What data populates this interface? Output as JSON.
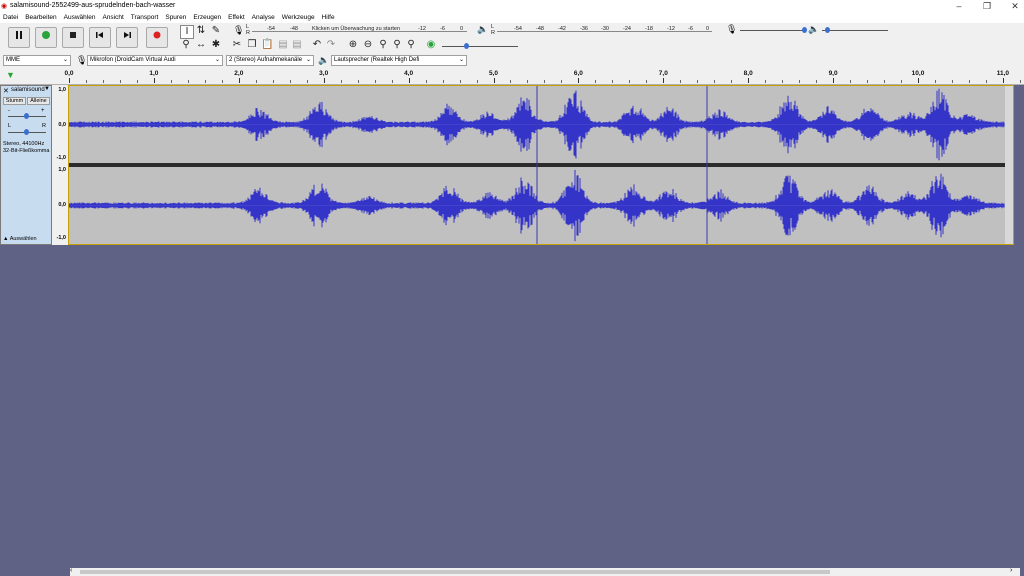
{
  "window": {
    "title": "salamisound-2552499-aus-sprudelnden-bach-wasser"
  },
  "menu": [
    "Datei",
    "Bearbeiten",
    "Auswählen",
    "Ansicht",
    "Transport",
    "Spuren",
    "Erzeugen",
    "Effekt",
    "Analyse",
    "Werkzeuge",
    "Hilfe"
  ],
  "meter": {
    "rec_hint": "Klicken um Überwachung zu starten",
    "rec_ticks": [
      "-54",
      "-48",
      "-12",
      "-6",
      "0"
    ],
    "play_ticks": [
      "-54",
      "-48",
      "-42",
      "-36",
      "-30",
      "-24",
      "-18",
      "-12",
      "-6",
      "0"
    ]
  },
  "devices": {
    "host": "MME",
    "mic": "Mikrofon (DroidCam Virtual Audi",
    "channels": "2 (Stereo) Aufnahmekanäle",
    "speaker": "Lautsprecher (Realtek High Defi"
  },
  "timeline": [
    "0,0",
    "1,0",
    "2,0",
    "3,0",
    "4,0",
    "5,0",
    "6,0",
    "7,0",
    "8,0",
    "9,0",
    "10,0",
    "11,0"
  ],
  "track": {
    "name": "salamisound",
    "mute": "Stumm",
    "solo": "Alleine",
    "pan_l": "L",
    "pan_r": "R",
    "info1": "Stereo, 44100Hz",
    "info2": "32-Bit-Fließkomma",
    "select": "Auswählen",
    "ruler": [
      "1,0",
      "0,5",
      "0,0",
      "-0,5",
      "-1,0"
    ]
  }
}
